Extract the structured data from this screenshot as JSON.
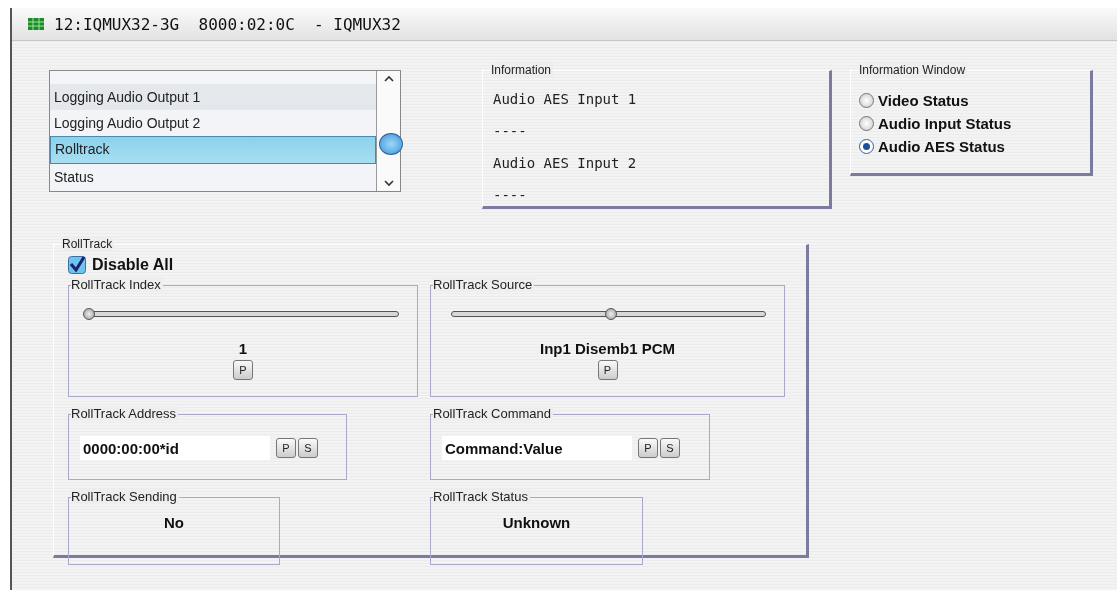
{
  "window": {
    "title": "12:IQMUX32-3G  8000:02:0C  - IQMUX32"
  },
  "list": {
    "items": [
      {
        "label": "Logging Audio Output 1",
        "selected": false
      },
      {
        "label": "Logging Audio Output 2",
        "selected": false
      },
      {
        "label": "Rolltrack",
        "selected": true
      },
      {
        "label": "Status",
        "selected": false
      }
    ]
  },
  "information": {
    "title": "Information",
    "lines": [
      "Audio AES Input 1",
      "----",
      "Audio AES Input 2",
      "----"
    ]
  },
  "information_window": {
    "title": "Information Window",
    "options": [
      {
        "label": "Video Status",
        "selected": false
      },
      {
        "label": "Audio Input Status",
        "selected": false
      },
      {
        "label": "Audio AES Status",
        "selected": true
      }
    ]
  },
  "rolltrack": {
    "title": "RollTrack",
    "disable_all": {
      "label": "Disable All",
      "checked": true
    },
    "panels": [
      {
        "kind": "slider",
        "title": "RollTrack Index",
        "level": 0,
        "value": "1",
        "buttons": [
          "P"
        ]
      },
      {
        "kind": "slider",
        "title": "RollTrack Source",
        "level": 0.49,
        "value": "Inp1 Disemb1 PCM",
        "buttons": [
          "P"
        ]
      },
      {
        "kind": "field",
        "title": "RollTrack Address",
        "value": "0000:00:00*id",
        "buttons": [
          "P",
          "S"
        ]
      },
      {
        "kind": "field",
        "title": "RollTrack Command",
        "value": "Command:Value",
        "buttons": [
          "P",
          "S"
        ]
      },
      {
        "kind": "readout",
        "title": "RollTrack Sending",
        "value": "No"
      },
      {
        "kind": "readout",
        "title": "RollTrack Status",
        "value": "Unknown"
      }
    ]
  }
}
